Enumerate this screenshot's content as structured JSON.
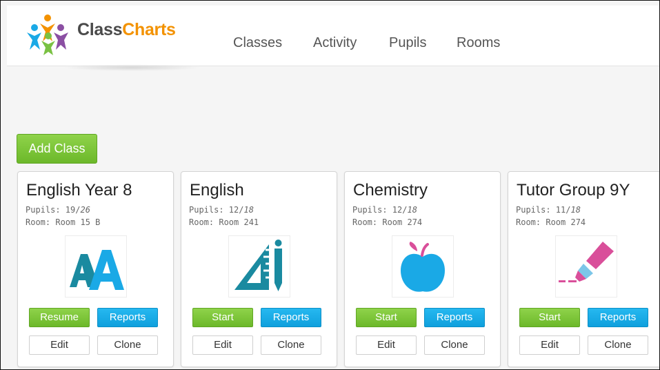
{
  "app": {
    "logo": {
      "text_part1": "Class",
      "text_part2": "Charts"
    },
    "nav": [
      "Classes",
      "Activity",
      "Pupils",
      "Rooms"
    ]
  },
  "toolbar": {
    "add_class_label": "Add Class"
  },
  "colors": {
    "green": "#7ac143",
    "blue": "#1aa9e6",
    "orange": "#f39200",
    "teal": "#1a8aa0",
    "pink": "#d94f9a"
  },
  "classes": [
    {
      "title": "English Year 8",
      "pupils_label": "Pupils: ",
      "pupils_present": "19",
      "pupils_total": "26",
      "room": "Room: Room 15 B",
      "icon": "letters-aa-icon",
      "primary_action": "Resume",
      "reports_label": "Reports",
      "edit_label": "Edit",
      "clone_label": "Clone"
    },
    {
      "title": "English",
      "pupils_label": "Pupils: ",
      "pupils_present": "12",
      "pupils_total": "18",
      "room": "Room: Room 241",
      "icon": "ruler-pencil-icon",
      "primary_action": "Start",
      "reports_label": "Reports",
      "edit_label": "Edit",
      "clone_label": "Clone"
    },
    {
      "title": "Chemistry",
      "pupils_label": "Pupils: ",
      "pupils_present": "12",
      "pupils_total": "18",
      "room": "Room: Room 274",
      "icon": "apple-icon",
      "primary_action": "Start",
      "reports_label": "Reports",
      "edit_label": "Edit",
      "clone_label": "Clone"
    },
    {
      "title": "Tutor Group 9Y",
      "pupils_label": "Pupils: ",
      "pupils_present": "11",
      "pupils_total": "18",
      "room": "Room: Room 274",
      "icon": "highlighter-icon",
      "primary_action": "Start",
      "reports_label": "Reports",
      "edit_label": "Edit",
      "clone_label": "Clone"
    }
  ]
}
